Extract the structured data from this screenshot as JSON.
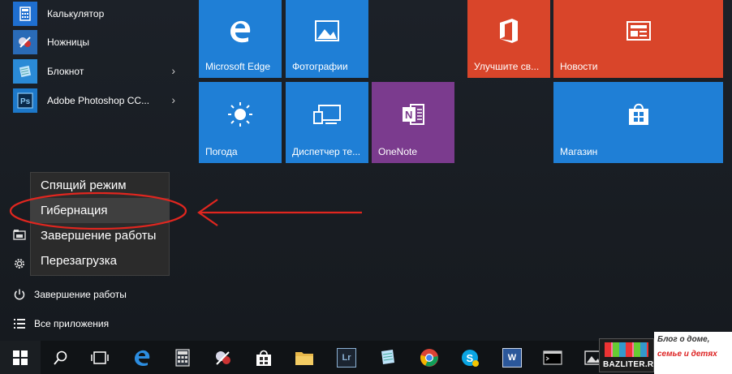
{
  "apps": [
    {
      "label": "Калькулятор",
      "icon": "calculator-icon",
      "color": "#1f6fd0",
      "has_submenu": false
    },
    {
      "label": "Ножницы",
      "icon": "scissors-icon",
      "color": "#2a6bb7",
      "has_submenu": false
    },
    {
      "label": "Блокнот",
      "icon": "notepad-icon",
      "color": "#2a8ad6",
      "has_submenu": true
    },
    {
      "label": "Adobe Photoshop CC...",
      "icon": "photoshop-icon",
      "color": "#1d78c9",
      "has_submenu": true
    }
  ],
  "power_menu": {
    "items": [
      "Спящий режим",
      "Гибернация",
      "Завершение работы",
      "Перезагрузка"
    ],
    "highlighted": "Гибернация"
  },
  "bottom": {
    "shutdown": "Завершение работы",
    "all_apps": "Все приложения"
  },
  "tiles": {
    "edge": {
      "label": "Microsoft Edge",
      "color": "#1f7fd6"
    },
    "photos": {
      "label": "Фотографии",
      "color": "#1f7fd6"
    },
    "office": {
      "label": "Улучшите св...",
      "color": "#d9452a"
    },
    "news": {
      "label": "Новости",
      "color": "#d9452a"
    },
    "weather": {
      "label": "Погода",
      "color": "#1f7fd6"
    },
    "devices": {
      "label": "Диспетчер те...",
      "color": "#1f7fd6"
    },
    "onenote": {
      "label": "OneNote",
      "color": "#7b3b8e"
    },
    "store": {
      "label": "Магазин",
      "color": "#1f7fd6"
    }
  },
  "taskbar": {
    "items": [
      "start-icon",
      "search-icon",
      "task-view-icon",
      "edge-icon",
      "calculator-icon",
      "scissors-icon",
      "store-icon",
      "file-explorer-icon",
      "lightroom-icon",
      "notepad-icon",
      "chrome-icon",
      "skype-icon",
      "word-icon",
      "cmd-icon",
      "photos-icon"
    ],
    "lightroom_label": "Lr",
    "word_label": "W"
  },
  "brand": {
    "logo": "BAZLITER.RU",
    "line1": "Блог о доме,",
    "line2": "семье и детях"
  },
  "colors": {
    "annotation": "#e0261f",
    "accent": "#1f7fd6"
  }
}
